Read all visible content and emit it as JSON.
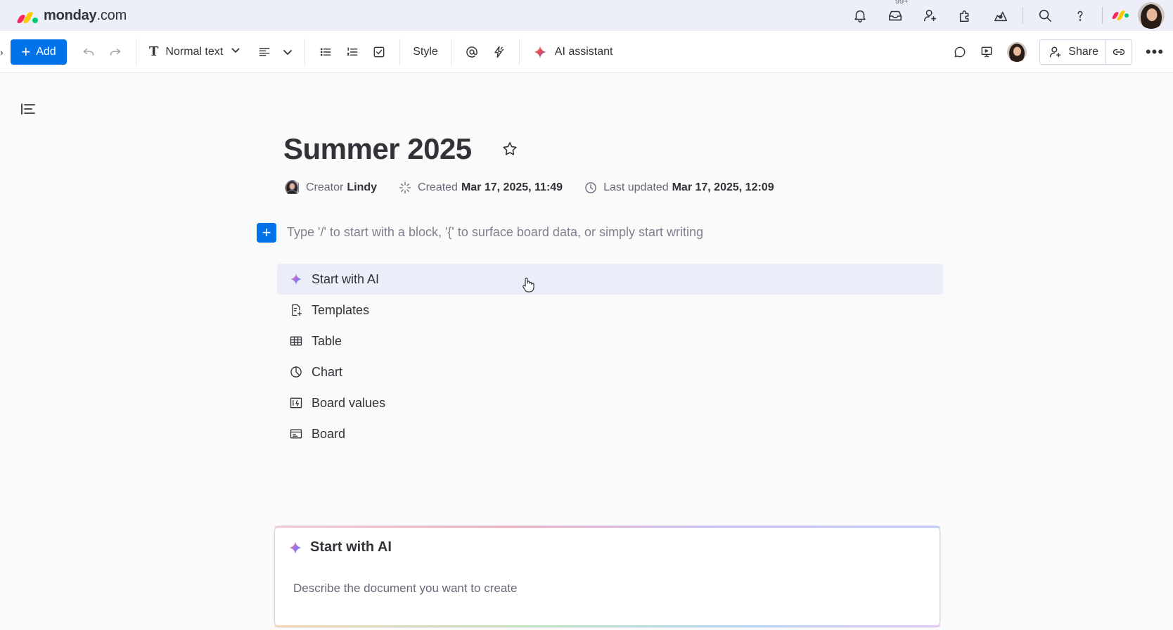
{
  "brand": {
    "name": "monday",
    "suffix": ".com",
    "colors": [
      "#fb275d",
      "#ffcb00",
      "#00ca72"
    ]
  },
  "topbar": {
    "inbox_badge": "99+",
    "icons": [
      "bell-icon",
      "inbox-icon",
      "invite-members-icon",
      "apps-icon",
      "templates-icon",
      "search-icon",
      "help-icon"
    ]
  },
  "toolbar": {
    "add_label": "Add",
    "text_style": "Normal text",
    "style_label": "Style",
    "ai_assistant_label": "AI assistant",
    "share_label": "Share"
  },
  "document": {
    "title": "Summer 2025",
    "creator_label": "Creator",
    "creator_name": "Lindy",
    "created_label": "Created",
    "created_value": "Mar 17, 2025, 11:49",
    "updated_label": "Last updated",
    "updated_value": "Mar 17, 2025, 12:09",
    "placeholder": "Type '/' to start with a block, '{' to surface board data, or simply start writing"
  },
  "block_menu": [
    {
      "label": "Start with AI",
      "icon": "sparkle-icon"
    },
    {
      "label": "Templates",
      "icon": "templates-doc-icon"
    },
    {
      "label": "Table",
      "icon": "table-icon"
    },
    {
      "label": "Chart",
      "icon": "chart-icon"
    },
    {
      "label": "Board values",
      "icon": "board-values-icon"
    },
    {
      "label": "Board",
      "icon": "board-icon"
    }
  ],
  "ai_panel": {
    "title": "Start with AI",
    "description": "Describe the document you want to create"
  },
  "colors": {
    "primary": "#0073ea",
    "topbar_bg": "#eceff8",
    "hover_row": "#ebeef8"
  }
}
